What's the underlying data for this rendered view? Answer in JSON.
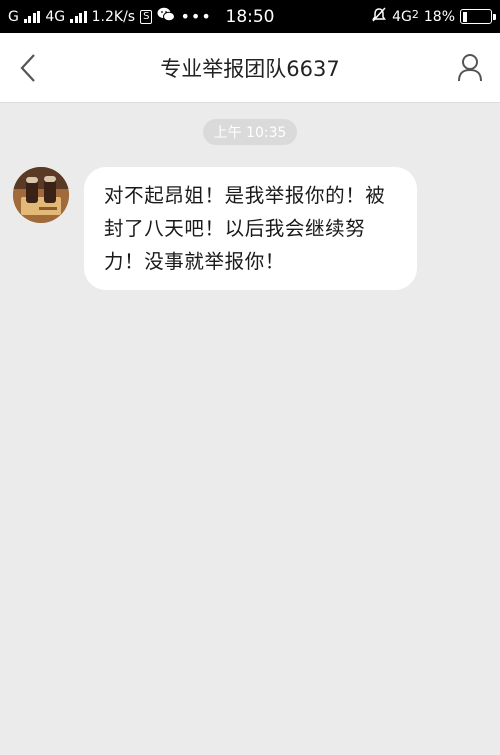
{
  "status_bar": {
    "carrier1": "G",
    "carrier2": "4G",
    "speed": "1.2K/s",
    "s_badge": "S",
    "more": "•••",
    "time": "18:50",
    "network": "4G",
    "network_sup": "2",
    "battery_pct": "18%",
    "battery_level": 0.18
  },
  "nav": {
    "title": "专业举报团队6637"
  },
  "chat": {
    "timestamp": "上午 10:35",
    "messages": [
      {
        "sender": "incoming",
        "text": "对不起昂姐！是我举报你的！被封了八天吧！以后我会继续努力！没事就举报你！"
      }
    ]
  }
}
